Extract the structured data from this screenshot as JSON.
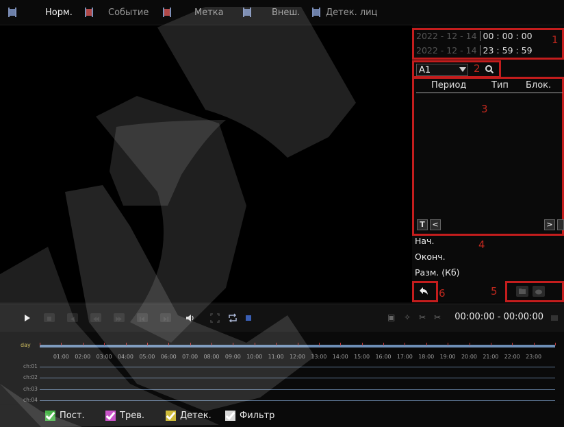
{
  "tabs": [
    {
      "label": "Норм.",
      "active": true,
      "icon": "film-icon"
    },
    {
      "label": "Событие",
      "active": false,
      "icon": "film-event-icon"
    },
    {
      "label": "Метка",
      "active": false,
      "icon": "film-mark-icon"
    },
    {
      "label": "Внеш.",
      "active": false,
      "icon": "film-external-icon"
    },
    {
      "label": "Детек. лиц",
      "active": false,
      "icon": "film-face-icon"
    }
  ],
  "search": {
    "start_date": "2022 - 12 - 14",
    "start_time": "00 : 00 : 00",
    "end_date": "2022 - 12 - 14",
    "end_time": "23 : 59 : 59",
    "channel": "A1"
  },
  "file_table": {
    "columns": [
      "Период",
      "Тип",
      "Блок."
    ],
    "rows": []
  },
  "list_nav": {
    "t": "T",
    "prev": "<",
    "next": ">"
  },
  "file_info": {
    "start_label": "Нач.",
    "end_label": "Оконч.",
    "size_label": "Разм. (Кб)"
  },
  "callouts": [
    "1",
    "2",
    "3",
    "4",
    "5",
    "6"
  ],
  "playback": {
    "time_range": "00:00:00  -  00:00:00"
  },
  "timeline": {
    "day_label": "day",
    "hours": [
      "01:00",
      "02:00",
      "03:00",
      "04:00",
      "05:00",
      "06:00",
      "07:00",
      "08:00",
      "09:00",
      "10:00",
      "11:00",
      "12:00",
      "13:00",
      "14:00",
      "15:00",
      "16:00",
      "17:00",
      "18:00",
      "19:00",
      "20:00",
      "21:00",
      "22:00",
      "23:00"
    ],
    "channels": [
      "ch:01",
      "ch:02",
      "ch:03",
      "ch:04"
    ]
  },
  "legend": [
    {
      "label": "Пост.",
      "color": "#2faa2f"
    },
    {
      "label": "Трев.",
      "color": "#c23cc2"
    },
    {
      "label": "Детек.",
      "color": "#c8b21e"
    },
    {
      "label": "Фильтр",
      "color": "#d8d8d8"
    }
  ],
  "colors": {
    "callout": "#c41d1d",
    "timeline_line": "#5d7694",
    "day_bar": "#6d8eb6"
  }
}
